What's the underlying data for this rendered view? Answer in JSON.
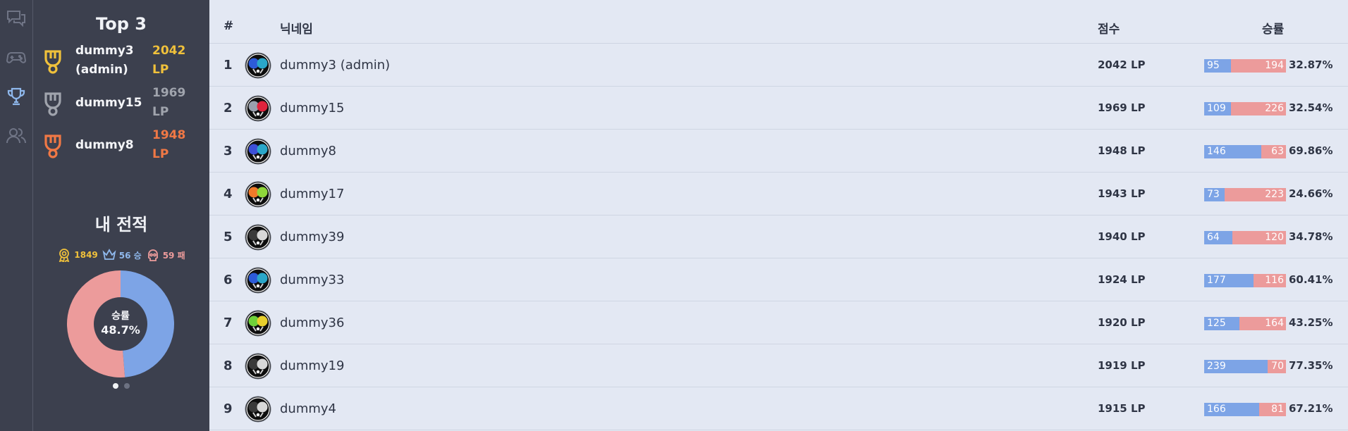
{
  "colors": {
    "gold": "#f0c13b",
    "silver": "#a0a4ad",
    "bronze": "#f07845",
    "win": "#7da4e6",
    "loss": "#ec9b9b",
    "sidebar_bg": "#3c404e",
    "main_bg": "#e3e8f3"
  },
  "nav": [
    {
      "icon": "chat-icon",
      "active": false
    },
    {
      "icon": "gamepad-icon",
      "active": false
    },
    {
      "icon": "trophy-icon",
      "active": true
    },
    {
      "icon": "users-icon",
      "active": false
    }
  ],
  "top3": {
    "title": "Top 3",
    "entries": [
      {
        "name": "dummy3 (admin)",
        "lp": "2042 LP",
        "medal": "gold"
      },
      {
        "name": "dummy15",
        "lp": "1969 LP",
        "medal": "silver"
      },
      {
        "name": "dummy8",
        "lp": "1948 LP",
        "medal": "bronze"
      }
    ]
  },
  "my_record": {
    "title": "내 전적",
    "lp": "1849",
    "wins": "56 승",
    "losses": "59 패",
    "center_label": "승률",
    "win_rate": "48.7%",
    "win_fraction": 0.487,
    "page_dots": 2,
    "active_dot": 0
  },
  "table": {
    "headers": {
      "rank": "#",
      "nickname": "닉네임",
      "score": "점수",
      "winrate": "승률"
    },
    "rows": [
      {
        "rank": "1",
        "name": "dummy3 (admin)",
        "lp": "2042 LP",
        "wins": 95,
        "losses": 194,
        "pct": "32.87%",
        "paddle_left": "#2d5bd8",
        "paddle_right": "#2aa7c9"
      },
      {
        "rank": "2",
        "name": "dummy15",
        "lp": "1969 LP",
        "wins": 109,
        "losses": 226,
        "pct": "32.54%",
        "paddle_left": "#9aa1ae",
        "paddle_right": "#e0243c"
      },
      {
        "rank": "3",
        "name": "dummy8",
        "lp": "1948 LP",
        "wins": 146,
        "losses": 63,
        "pct": "69.86%",
        "paddle_left": "#3d4fd8",
        "paddle_right": "#2aa7c9"
      },
      {
        "rank": "4",
        "name": "dummy17",
        "lp": "1943 LP",
        "wins": 73,
        "losses": 223,
        "pct": "24.66%",
        "paddle_left": "#f07a2a",
        "paddle_right": "#8fd63a"
      },
      {
        "rank": "5",
        "name": "dummy39",
        "lp": "1940 LP",
        "wins": 64,
        "losses": 120,
        "pct": "34.78%",
        "paddle_left": "#3a3a3a",
        "paddle_right": "#d8d8d8"
      },
      {
        "rank": "6",
        "name": "dummy33",
        "lp": "1924 LP",
        "wins": 177,
        "losses": 116,
        "pct": "60.41%",
        "paddle_left": "#2d5bd8",
        "paddle_right": "#2aa7c9"
      },
      {
        "rank": "7",
        "name": "dummy36",
        "lp": "1920 LP",
        "wins": 125,
        "losses": 164,
        "pct": "43.25%",
        "paddle_left": "#6fd23a",
        "paddle_right": "#e8cf2c"
      },
      {
        "rank": "8",
        "name": "dummy19",
        "lp": "1919 LP",
        "wins": 239,
        "losses": 70,
        "pct": "77.35%",
        "paddle_left": "#3a3a3a",
        "paddle_right": "#d8d8d8"
      },
      {
        "rank": "9",
        "name": "dummy4",
        "lp": "1915 LP",
        "wins": 166,
        "losses": 81,
        "pct": "67.21%",
        "paddle_left": "#3a3a3a",
        "paddle_right": "#d8d8d8"
      }
    ]
  }
}
